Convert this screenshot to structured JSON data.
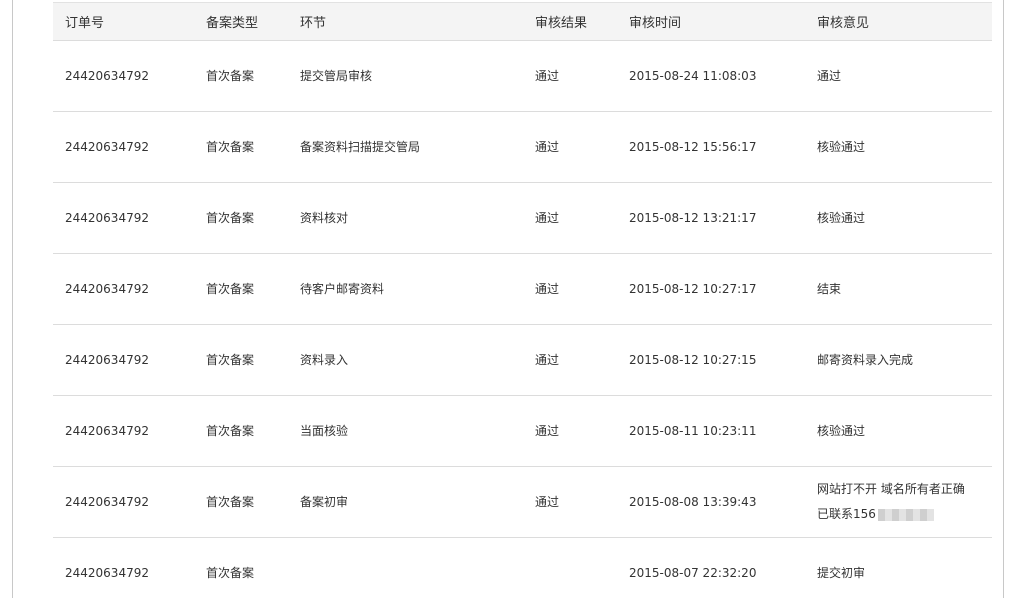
{
  "headers": {
    "order_no": "订单号",
    "record_type": "备案类型",
    "stage": "环节",
    "result": "审核结果",
    "time": "审核时间",
    "opinion": "审核意见"
  },
  "rows": [
    {
      "order_no": "24420634792",
      "record_type": "首次备案",
      "stage": "提交管局审核",
      "result": "通过",
      "time": "2015-08-24 11:08:03",
      "opinion": "通过"
    },
    {
      "order_no": "24420634792",
      "record_type": "首次备案",
      "stage": "备案资料扫描提交管局",
      "result": "通过",
      "time": "2015-08-12 15:56:17",
      "opinion": "核验通过"
    },
    {
      "order_no": "24420634792",
      "record_type": "首次备案",
      "stage": "资料核对",
      "result": "通过",
      "time": "2015-08-12 13:21:17",
      "opinion": "核验通过"
    },
    {
      "order_no": "24420634792",
      "record_type": "首次备案",
      "stage": "待客户邮寄资料",
      "result": "通过",
      "time": "2015-08-12 10:27:17",
      "opinion": "结束"
    },
    {
      "order_no": "24420634792",
      "record_type": "首次备案",
      "stage": "资料录入",
      "result": "通过",
      "time": "2015-08-12 10:27:15",
      "opinion": "邮寄资料录入完成"
    },
    {
      "order_no": "24420634792",
      "record_type": "首次备案",
      "stage": "当面核验",
      "result": "通过",
      "time": "2015-08-11 10:23:11",
      "opinion": "核验通过"
    },
    {
      "order_no": "24420634792",
      "record_type": "首次备案",
      "stage": "备案初审",
      "result": "通过",
      "time": "2015-08-08 13:39:43",
      "opinion_line1": "网站打不开 域名所有者正确",
      "opinion_line2": "已联系156"
    },
    {
      "order_no": "24420634792",
      "record_type": "首次备案",
      "stage": "",
      "result": "",
      "time": "2015-08-07 22:32:20",
      "opinion": "提交初审"
    }
  ]
}
